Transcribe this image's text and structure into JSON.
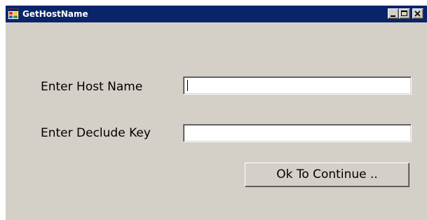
{
  "window": {
    "title": "GetHostName",
    "title_bar_color": "#0a246a",
    "background_color": "#d4d0c8",
    "app_icon": "windows-form-icon",
    "controls": {
      "minimize_icon": "minimize-icon",
      "maximize_icon": "maximize-icon",
      "close_icon": "close-icon"
    }
  },
  "form": {
    "host_name_label": "Enter Host Name",
    "host_name_value": "",
    "declude_key_label": "Enter Declude Key",
    "declude_key_value": "",
    "continue_button_label": "Ok To Continue .."
  }
}
